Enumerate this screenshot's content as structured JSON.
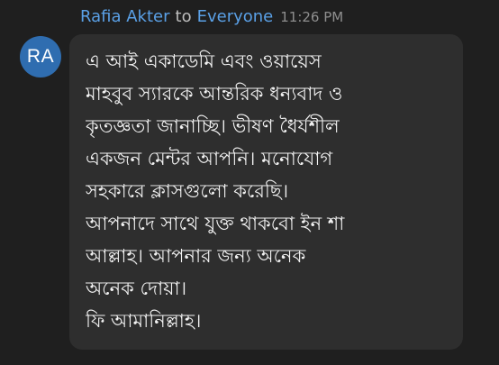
{
  "message": {
    "sender": "Rafia Akter",
    "to_word": "to",
    "recipient": "Everyone",
    "timestamp": "11:26 PM",
    "avatar_initials": "RA",
    "lines": [
      "এ আই একাডেমি এবং ওয়ায়েস",
      "মাহবুব স্যারকে আন্তরিক  ধন্যবাদ ও",
      "কৃতজ্ঞতা জানাচ্ছি। ভীষণ ধৈর্যশীল",
      "একজন  মেন্টর আপনি। মনোযোগ",
      "সহকারে ক্লাসগুলো করেছি।",
      "আপনাদে সাথে যুক্ত থাকবো ইন শা",
      "আল্লাহ। আপনার জন্য অনেক",
      "অনেক দোয়া।",
      "ফি আমানিল্লাহ।"
    ]
  },
  "colors": {
    "background": "#1f1f1f",
    "bubble": "#2e2e2e",
    "name_link": "#5aa0e6",
    "avatar": "#2f6db0",
    "message_text": "#f2f2f2",
    "timestamp": "#8e8e8e"
  }
}
